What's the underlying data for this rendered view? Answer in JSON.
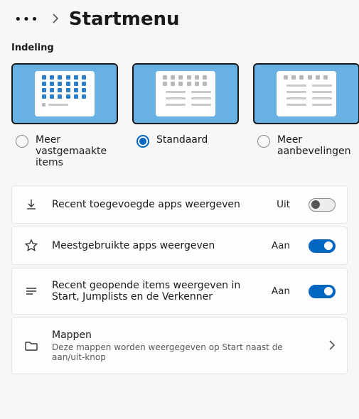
{
  "breadcrumb": {
    "title": "Startmenu"
  },
  "layout": {
    "section_label": "Indeling",
    "options": [
      {
        "label": "Meer vastgemaakte items",
        "selected": false
      },
      {
        "label": "Standaard",
        "selected": true
      },
      {
        "label": "Meer aanbevelingen",
        "selected": false
      }
    ]
  },
  "states": {
    "on": "Aan",
    "off": "Uit"
  },
  "settings": [
    {
      "id": "recent-apps",
      "title": "Recent toegevoegde apps weergeven",
      "sub": "",
      "state": "off"
    },
    {
      "id": "most-used",
      "title": "Meestgebruikte apps weergeven",
      "sub": "",
      "state": "on"
    },
    {
      "id": "recent-items",
      "title": "Recent geopende items weergeven in Start, Jumplists en de Verkenner",
      "sub": "",
      "state": "on"
    }
  ],
  "folders": {
    "title": "Mappen",
    "sub": "Deze mappen worden weergegeven op Start naast de aan/uit-knop"
  }
}
